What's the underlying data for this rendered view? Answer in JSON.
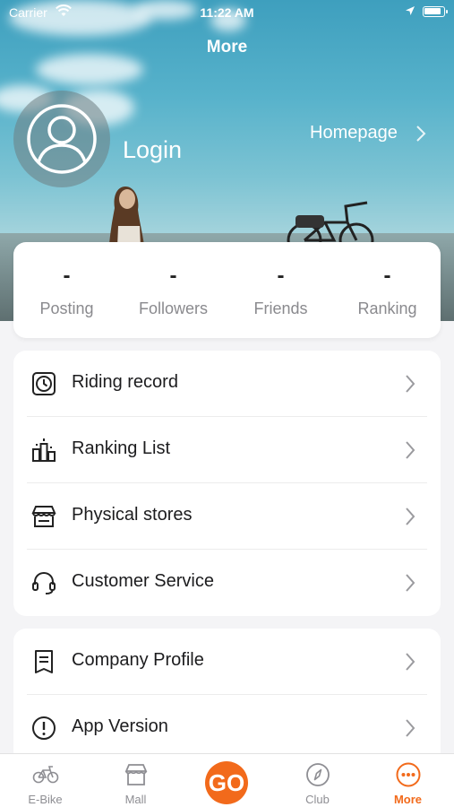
{
  "status_bar": {
    "carrier": "Carrier",
    "time": "11:22 AM"
  },
  "header": {
    "title": "More",
    "login_label": "Login",
    "homepage_label": "Homepage"
  },
  "stats": [
    {
      "value": "-",
      "label": "Posting"
    },
    {
      "value": "-",
      "label": "Followers"
    },
    {
      "value": "-",
      "label": "Friends"
    },
    {
      "value": "-",
      "label": "Ranking"
    }
  ],
  "menu_primary": [
    {
      "label": "Riding record",
      "icon": "clock-icon"
    },
    {
      "label": "Ranking List",
      "icon": "ranking-icon"
    },
    {
      "label": "Physical stores",
      "icon": "store-icon"
    },
    {
      "label": "Customer Service",
      "icon": "headset-icon"
    }
  ],
  "menu_secondary": [
    {
      "label": "Company Profile",
      "icon": "document-icon"
    },
    {
      "label": "App Version",
      "icon": "info-icon"
    }
  ],
  "tabbar": {
    "tabs": [
      {
        "label": "E-Bike",
        "icon": "bike-icon",
        "active": false
      },
      {
        "label": "Mall",
        "icon": "shop-icon",
        "active": false
      },
      {
        "label": "GO",
        "icon": "go-button",
        "active": false
      },
      {
        "label": "Club",
        "icon": "compass-icon",
        "active": false
      },
      {
        "label": "More",
        "icon": "more-icon",
        "active": true
      }
    ]
  },
  "colors": {
    "accent": "#F26A1B",
    "text_primary": "#1C1C1E",
    "text_secondary": "#8A8A8E"
  }
}
